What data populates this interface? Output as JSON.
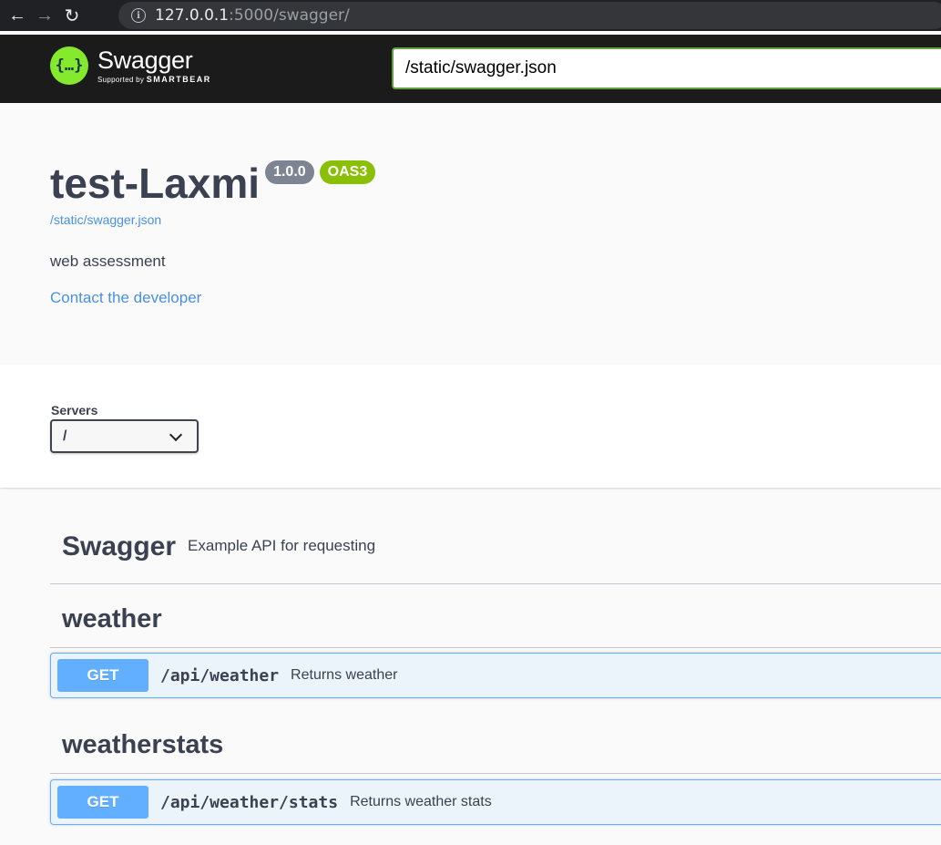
{
  "browser": {
    "url_host": "127.0.0.1",
    "url_path": ":5000/swagger/"
  },
  "topbar": {
    "logo_name": "Swagger",
    "logo_supported_by": "Supported by",
    "logo_brand": "SMARTBEAR",
    "spec_url": "/static/swagger.json"
  },
  "info": {
    "title": "test-Laxmi",
    "version": "1.0.0",
    "oas_badge": "OAS3",
    "spec_link": "/static/swagger.json",
    "description": "web assessment",
    "contact_link": "Contact the developer"
  },
  "servers": {
    "label": "Servers",
    "selected": "/"
  },
  "api": {
    "name": "Swagger",
    "description": "Example API for requesting"
  },
  "tags": [
    {
      "name": "weather",
      "operations": [
        {
          "method": "GET",
          "path": "/api/weather",
          "summary": "Returns weather"
        }
      ]
    },
    {
      "name": "weatherstats",
      "operations": [
        {
          "method": "GET",
          "path": "/api/weather/stats",
          "summary": "Returns weather stats"
        }
      ]
    }
  ],
  "colors": {
    "get_method": "#61affe",
    "oas_badge": "#89bf04",
    "version_badge": "#7d8492",
    "link": "#4990e2",
    "logo_green": "#85ea2d"
  }
}
